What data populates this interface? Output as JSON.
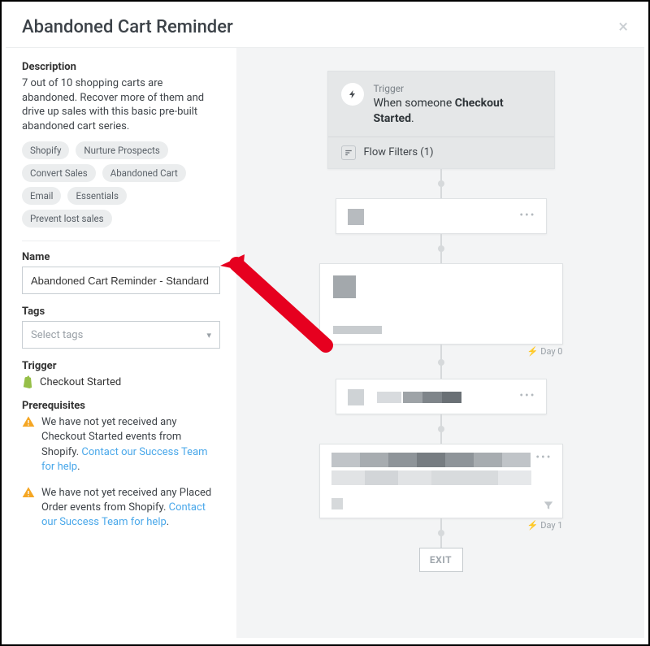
{
  "header": {
    "title": "Abandoned Cart Reminder"
  },
  "description": {
    "label": "Description",
    "text": "7 out of 10 shopping carts are abandoned. Recover more of them and drive up sales with this basic pre-built abandoned cart series.",
    "tags": [
      "Shopify",
      "Nurture Prospects",
      "Convert Sales",
      "Abandoned Cart",
      "Email",
      "Essentials",
      "Prevent lost sales"
    ]
  },
  "name": {
    "label": "Name",
    "value": "Abandoned Cart Reminder - Standard"
  },
  "tags_field": {
    "label": "Tags",
    "placeholder": "Select tags"
  },
  "trigger": {
    "label": "Trigger",
    "value": "Checkout Started"
  },
  "prerequisites": {
    "label": "Prerequisites",
    "items": [
      {
        "text": "We have not yet received any Checkout Started events from Shopify. ",
        "link": "Contact our Success Team for help",
        "suffix": "."
      },
      {
        "text": "We have not yet received any Placed Order events from Shopify. ",
        "link": "Contact our Success Team for help",
        "suffix": "."
      }
    ]
  },
  "canvas": {
    "trigger_node": {
      "label": "Trigger",
      "line_prefix": "When someone ",
      "line_bold": "Checkout Started",
      "line_suffix": ".",
      "filters": "Flow Filters (1)"
    },
    "day0": "Day 0",
    "day1": "Day 1",
    "exit": "EXIT"
  }
}
